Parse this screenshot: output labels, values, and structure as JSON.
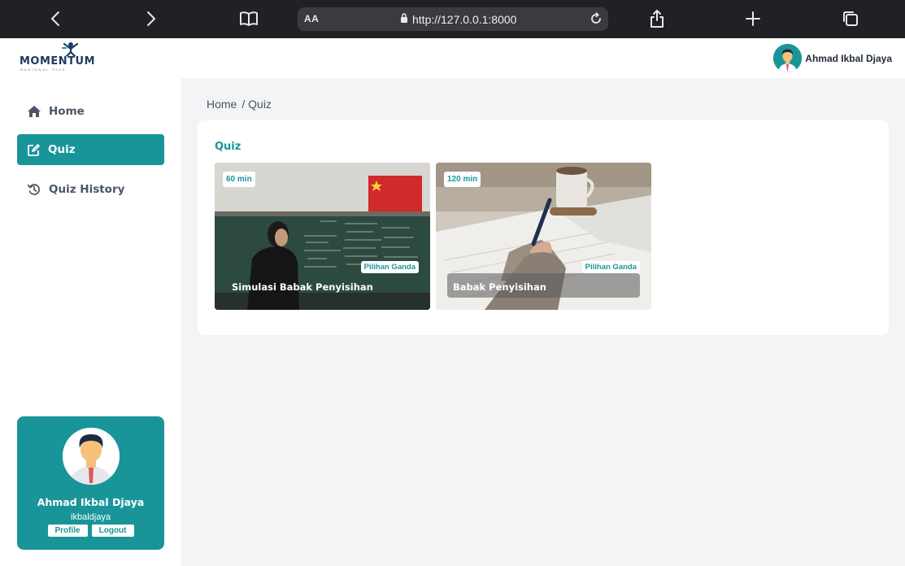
{
  "browser": {
    "aa_label": "AA",
    "url": "http://127.0.0.1:8000"
  },
  "header": {
    "logo_text": "MOMENTUM",
    "logo_subtext": "NASIONAL 2023",
    "user_name": "Ahmad Ikbal Djaya"
  },
  "sidebar": {
    "items": [
      {
        "label": "Home",
        "icon": "home-icon"
      },
      {
        "label": "Quiz",
        "icon": "edit-icon",
        "active": true
      },
      {
        "label": "Quiz History",
        "icon": "history-icon"
      }
    ],
    "profile": {
      "name": "Ahmad Ikbal Djaya",
      "username": "ikbaldjaya",
      "profile_button": "Profile",
      "logout_button": "Logout"
    }
  },
  "breadcrumb": {
    "home": "Home",
    "current": "/ Quiz"
  },
  "quiz_panel": {
    "title": "Quiz",
    "cards": [
      {
        "duration": "60 min",
        "type": "Pilihan Ganda",
        "title": "Simulasi Babak Penyisihan"
      },
      {
        "duration": "120 min",
        "type": "Pilihan Ganda",
        "title": "Babak Penyisihan"
      }
    ]
  },
  "colors": {
    "accent": "#19959a",
    "browser_bar": "#1f2124",
    "page_bg": "#f3f4f6"
  }
}
